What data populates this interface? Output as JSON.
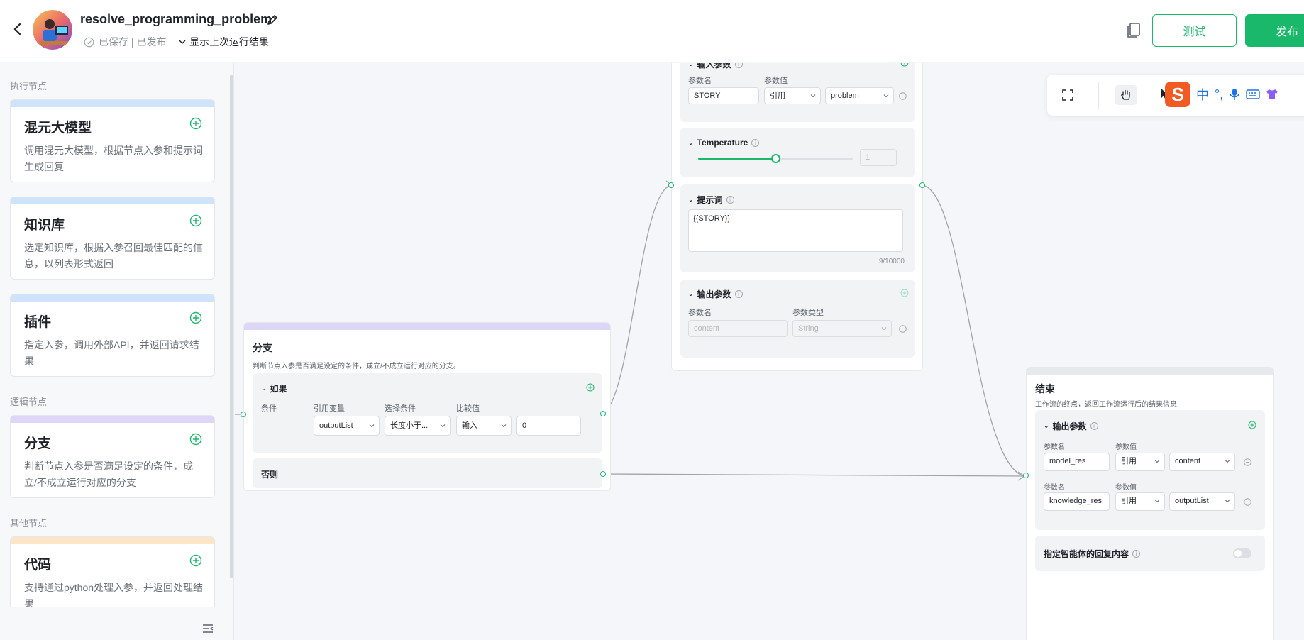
{
  "header": {
    "app_title": "resolve_programming_problem",
    "status_text": "已保存 | 已发布",
    "show_last_run": "显示上次运行结果",
    "test_label": "测试",
    "publish_label": "发布"
  },
  "sidebar": {
    "sections": {
      "exec": "执行节点",
      "logic": "逻辑节点",
      "other": "其他节点"
    },
    "nodes": [
      {
        "name": "混元大模型",
        "desc": "调用混元大模型，根据节点入参和提示词生成回复",
        "color": "#cfe3fb"
      },
      {
        "name": "知识库",
        "desc": "选定知识库，根据入参召回最佳匹配的信息，以列表形式返回",
        "color": "#cfe3fb"
      },
      {
        "name": "插件",
        "desc": "指定入参，调用外部API，并返回请求结果",
        "color": "#cfe3fb"
      },
      {
        "name": "分支",
        "desc": "判断节点入参是否满足设定的条件，成立/不成立运行对应的分支",
        "color": "#ddd6f7"
      },
      {
        "name": "代码",
        "desc": "支持通过python处理入参，并返回处理结果",
        "color": "#fde5c7"
      }
    ]
  },
  "llm_node": {
    "input_params_title": "输入参数",
    "param_name_header": "参数名",
    "param_value_header": "参数值",
    "input_name": "STORY",
    "input_ref": "引用",
    "input_value": "problem",
    "temperature_title": "Temperature",
    "temperature_value": "1",
    "temperature_fraction": 0.5,
    "prompt_title": "提示词",
    "prompt_text": "{{STORY}}",
    "prompt_count": "9/10000",
    "output_params_title": "输出参数",
    "param_type_header": "参数类型",
    "output_name": "content",
    "output_type": "String"
  },
  "branch_node": {
    "title": "分支",
    "desc": "判断节点入参是否满足设定的条件，成立/不成立运行对应的分支。",
    "if_label": "如果",
    "cond_header": "条件",
    "ref_var_header": "引用变量",
    "select_cond_header": "选择条件",
    "compare_header": "比较值",
    "ref_var": "outputList",
    "condition": "长度小于...",
    "compare_type": "输入",
    "compare_value": "0",
    "else_label": "否则"
  },
  "end_node": {
    "title": "结束",
    "desc": "工作流的终点，返回工作流运行后的结果信息",
    "output_title": "输出参数",
    "param_name_header": "参数名",
    "param_value_header": "参数值",
    "rows": [
      {
        "name": "model_res",
        "ref": "引用",
        "value": "content"
      },
      {
        "name": "knowledge_res",
        "ref": "引用",
        "value": "outputList"
      }
    ],
    "reply_label": "指定智能体的回复内容"
  },
  "ime": {
    "lang": "中",
    "punct": "°,"
  },
  "colors": {
    "accent": "#19b86a",
    "wire": "#a0a4aa"
  }
}
